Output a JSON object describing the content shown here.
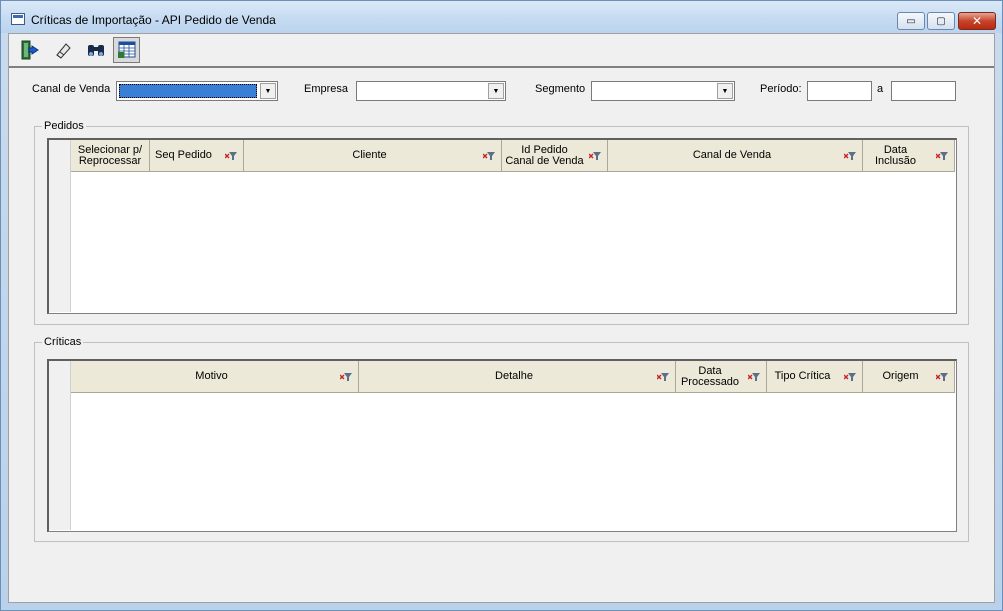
{
  "window": {
    "title": "Críticas de Importação - API Pedido de Venda"
  },
  "titlebar_buttons": {
    "minimize": "▭",
    "maximize": "▢",
    "close": "✕"
  },
  "toolbar": {
    "items": [
      {
        "name": "exit",
        "icon": "exit-door-icon"
      },
      {
        "name": "clear",
        "icon": "eraser-icon"
      },
      {
        "name": "search",
        "icon": "binoculars-icon"
      },
      {
        "name": "reprocess",
        "icon": "grid-process-icon"
      }
    ]
  },
  "filters": {
    "canal_label": "Canal de Venda",
    "empresa_label": "Empresa",
    "segmento_label": "Segmento",
    "periodo_label": "Período:",
    "periodo_sep": "a",
    "canal_value": "",
    "empresa_value": "",
    "segmento_value": "",
    "periodo_de": "",
    "periodo_ate": ""
  },
  "pedidos": {
    "legend": "Pedidos",
    "columns": [
      {
        "label": "Selecionar p/\nReprocessar",
        "filter": false
      },
      {
        "label": "Seq Pedido",
        "filter": true
      },
      {
        "label": "Cliente",
        "filter": true
      },
      {
        "label": "Id Pedido\nCanal de Venda",
        "filter": true
      },
      {
        "label": "Canal de Venda",
        "filter": true
      },
      {
        "label": "Data\nInclusão",
        "filter": true
      }
    ],
    "rows": []
  },
  "criticas": {
    "legend": "Críticas",
    "columns": [
      {
        "label": "Motivo",
        "filter": true
      },
      {
        "label": "Detalhe",
        "filter": true
      },
      {
        "label": "Data\nProcessado",
        "filter": true
      },
      {
        "label": "Tipo Crítica",
        "filter": true
      },
      {
        "label": "Origem",
        "filter": true
      }
    ],
    "rows": []
  },
  "colors": {
    "selection": "#3a7fd6",
    "header_bg": "#ece9d8",
    "filter_icon": "#cc2222"
  }
}
